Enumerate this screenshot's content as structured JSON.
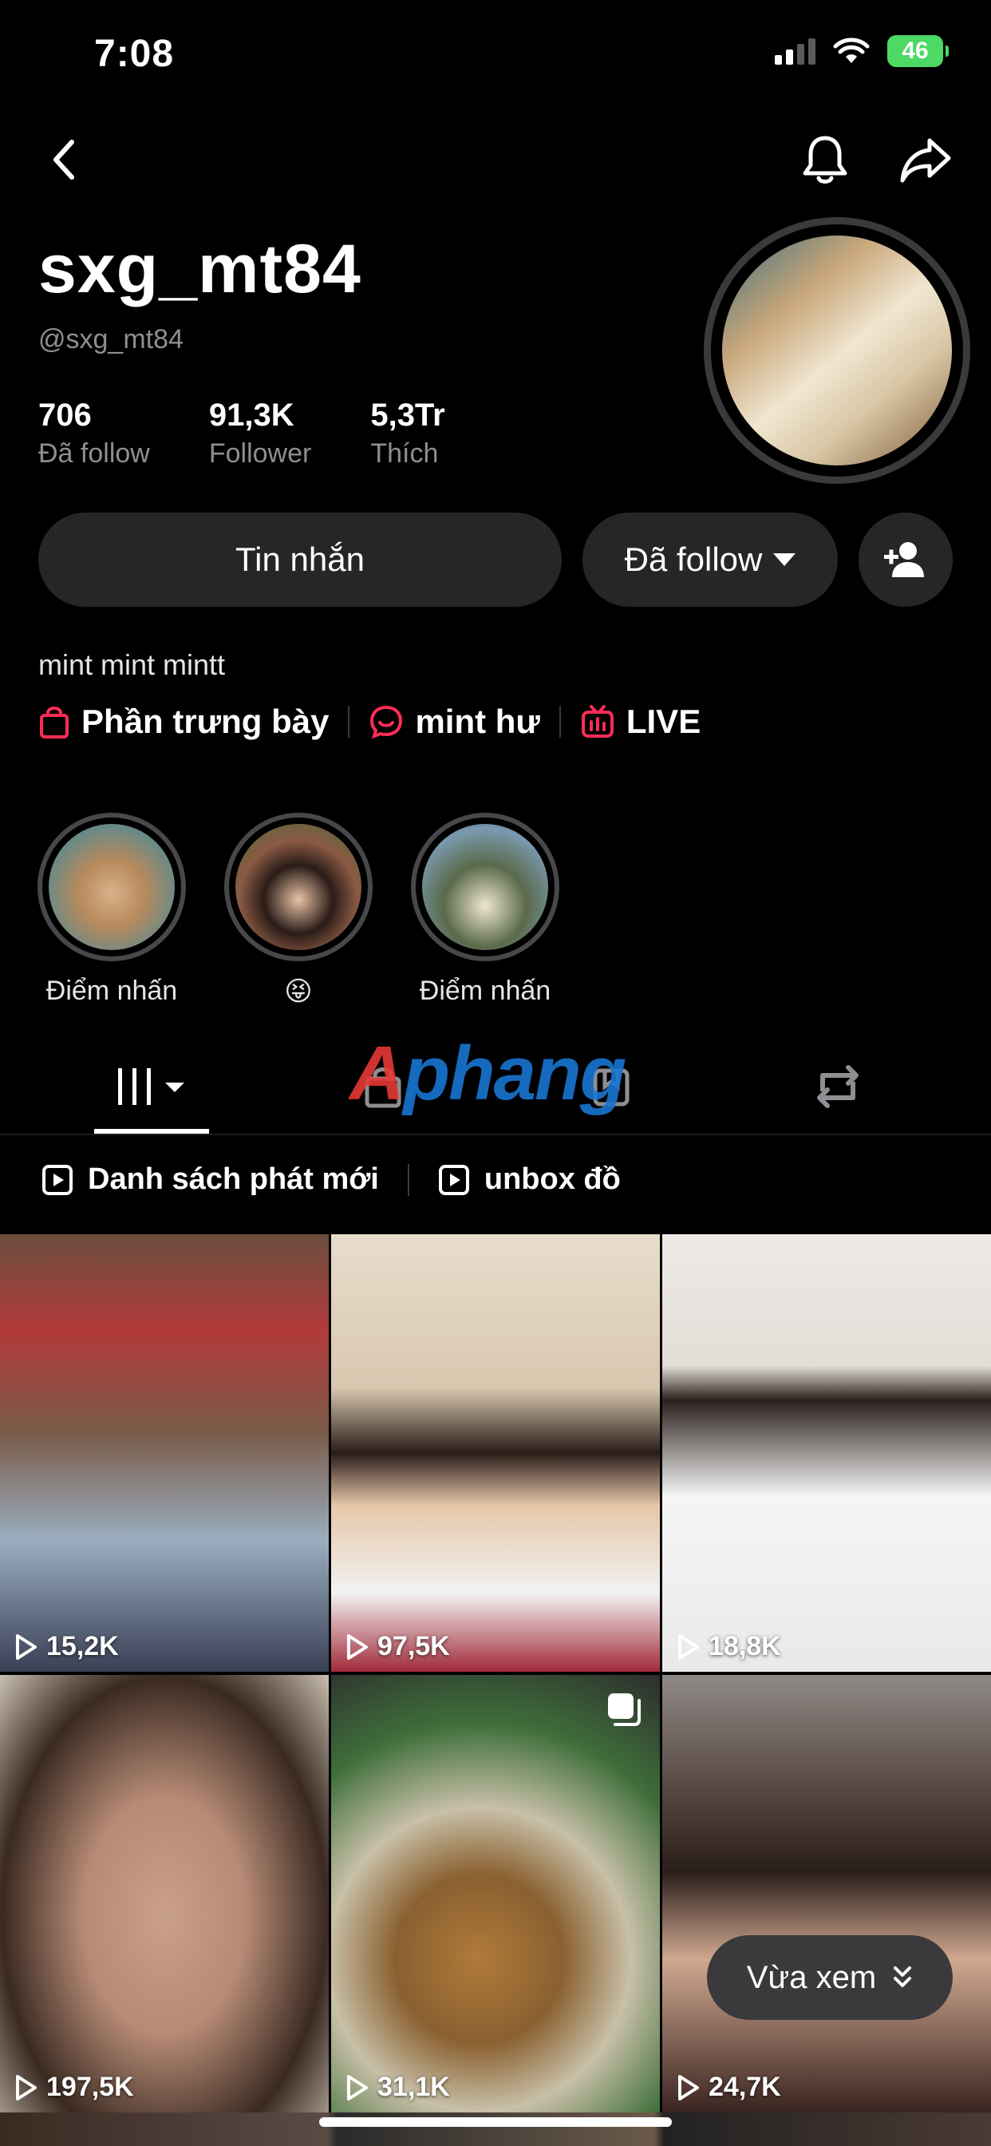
{
  "status_bar": {
    "time": "7:08",
    "battery": "46"
  },
  "profile": {
    "name": "sxg_mt84",
    "handle": "@sxg_mt84",
    "stats": [
      {
        "value": "706",
        "label": "Đã follow"
      },
      {
        "value": "91,3K",
        "label": "Follower"
      },
      {
        "value": "5,3Tr",
        "label": "Thích"
      }
    ],
    "bio": "mint mint mintt"
  },
  "actions": {
    "message": "Tin nhắn",
    "following": "Đã follow"
  },
  "links": [
    {
      "label": "Phần trưng bày",
      "icon": "shopping-bag-icon"
    },
    {
      "label": "mint hư",
      "icon": "chat-icon"
    },
    {
      "label": "LIVE",
      "icon": "live-tv-icon"
    }
  ],
  "highlights": [
    {
      "label": "Điểm nhấn"
    },
    {
      "label": "😝"
    },
    {
      "label": "Điểm nhấn"
    }
  ],
  "watermark": {
    "a": "A",
    "rest": "phang"
  },
  "playlists": [
    {
      "label": "Danh sách phát mới"
    },
    {
      "label": "unbox đồ"
    }
  ],
  "videos": [
    {
      "views": "15,2K"
    },
    {
      "views": "97,5K"
    },
    {
      "views": "18,8K"
    },
    {
      "views": "197,5K"
    },
    {
      "views": "31,1K"
    },
    {
      "views": "24,7K"
    }
  ],
  "recently_viewed": "Vừa xem",
  "colors": {
    "accent_red": "#fe2c55",
    "button_bg": "#262628",
    "secondary_text": "#8e8e93"
  }
}
